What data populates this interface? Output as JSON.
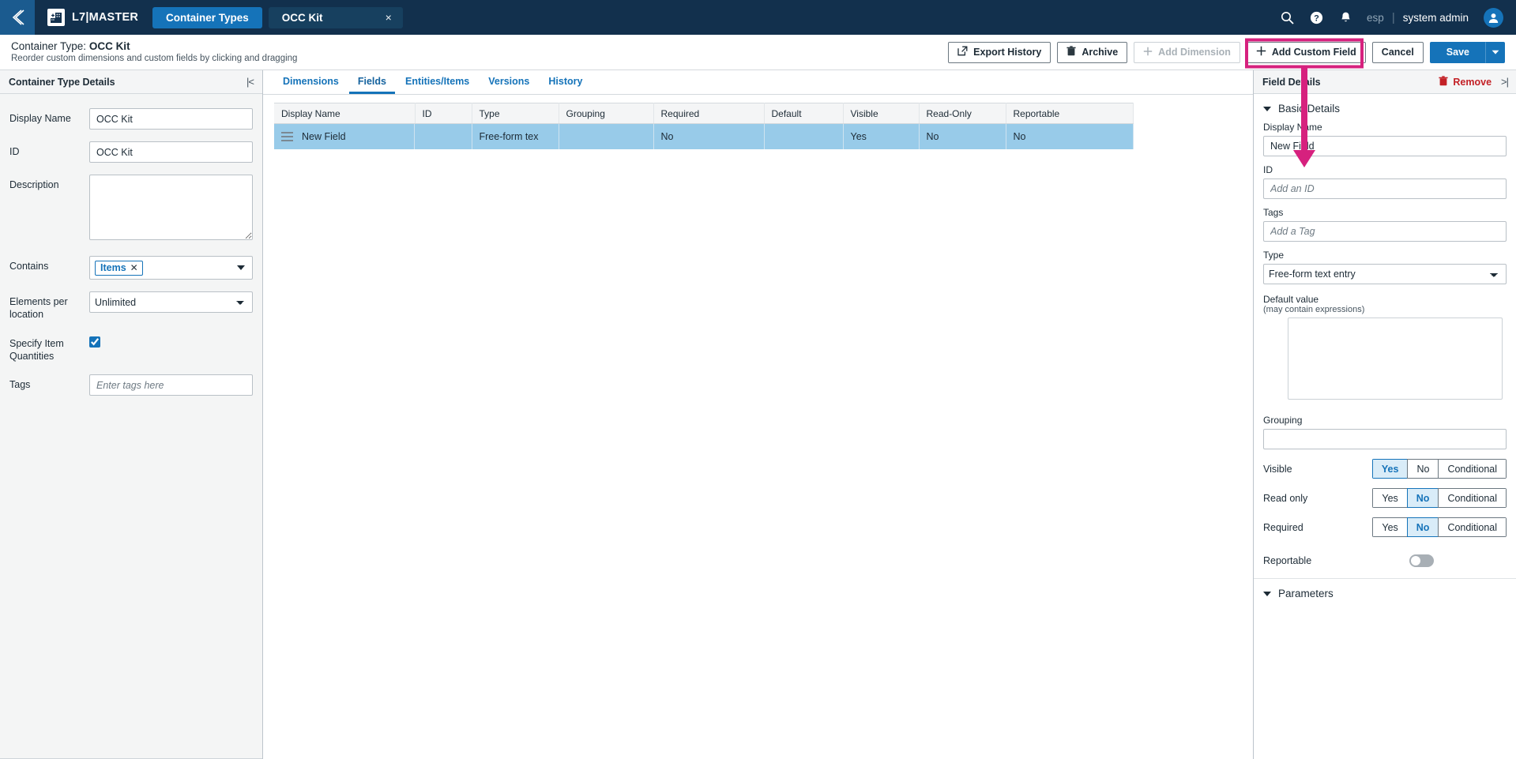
{
  "topnav": {
    "back_icon": "chevron-left-icon",
    "org_icon": "building-add-icon",
    "org_name": "L7|MASTER",
    "tabs": [
      {
        "label": "Container Types",
        "active": true,
        "closable": false
      },
      {
        "label": "OCC Kit",
        "active": false,
        "closable": true,
        "close": "×"
      }
    ],
    "icons": [
      "search-icon",
      "help-icon",
      "notifications-icon"
    ],
    "locale": "esp",
    "separator": "|",
    "user": "system admin",
    "avatar_icon": "user-avatar-icon"
  },
  "page_header": {
    "title_prefix": "Container Type: ",
    "title_value": "OCC Kit",
    "subtitle": "Reorder custom dimensions and custom fields by clicking and dragging",
    "buttons": {
      "export_history": "Export History",
      "archive": "Archive",
      "add_dimension": "Add Dimension",
      "add_custom_field": "Add Custom Field",
      "cancel": "Cancel",
      "save": "Save"
    }
  },
  "annotation": {
    "color": "#d6217e",
    "target": "Add Custom Field",
    "points_to": "Display Name"
  },
  "left_panel": {
    "header": "Container Type Details",
    "collapse_icon": "collapse-left-icon",
    "fields": {
      "display_name_label": "Display Name",
      "display_name_value": "OCC Kit",
      "id_label": "ID",
      "id_value": "OCC Kit",
      "description_label": "Description",
      "description_value": "",
      "contains_label": "Contains",
      "contains_chip": "Items",
      "contains_chip_remove": "✕",
      "elements_label": "Elements per location",
      "elements_value": "Unlimited",
      "specify_label": "Specify Item Quantities",
      "specify_checked": true,
      "tags_label": "Tags",
      "tags_placeholder": "Enter tags here",
      "tags_value": ""
    }
  },
  "center_panel": {
    "tabs": [
      {
        "label": "Dimensions",
        "active": false
      },
      {
        "label": "Fields",
        "active": true
      },
      {
        "label": "Entities/Items",
        "active": false
      },
      {
        "label": "Versions",
        "active": false
      },
      {
        "label": "History",
        "active": false
      }
    ],
    "table": {
      "columns": [
        "Display Name",
        "ID",
        "Type",
        "Grouping",
        "Required",
        "Default",
        "Visible",
        "Read-Only",
        "Reportable"
      ],
      "rows": [
        {
          "selected": true,
          "drag_handle": "drag-handle-icon",
          "display_name": "New Field",
          "id": "",
          "type": "Free-form tex",
          "grouping": "",
          "required": "No",
          "default": "",
          "visible": "Yes",
          "read_only": "No",
          "reportable": "No"
        }
      ]
    }
  },
  "right_panel": {
    "header": "Field Details",
    "remove_label": "Remove",
    "remove_icon": "trash-icon",
    "expand_icon": "collapse-right-icon",
    "sections": {
      "basic_details": "Basic Details",
      "parameters": "Parameters"
    },
    "fields": {
      "display_name_label": "Display Name",
      "display_name_value": "New Field",
      "id_label": "ID",
      "id_placeholder": "Add an ID",
      "id_value": "",
      "tags_label": "Tags",
      "tags_placeholder": "Add a Tag",
      "tags_value": "",
      "type_label": "Type",
      "type_value": "Free-form text entry",
      "default_label": "Default value",
      "default_sub": "(may contain expressions)",
      "default_value": "",
      "grouping_label": "Grouping",
      "grouping_value": "",
      "visible_label": "Visible",
      "visible_value": "Yes",
      "read_only_label": "Read only",
      "read_only_value": "No",
      "required_label": "Required",
      "required_value": "No",
      "reportable_label": "Reportable",
      "reportable_on": false,
      "segment_options": [
        "Yes",
        "No",
        "Conditional"
      ]
    }
  }
}
